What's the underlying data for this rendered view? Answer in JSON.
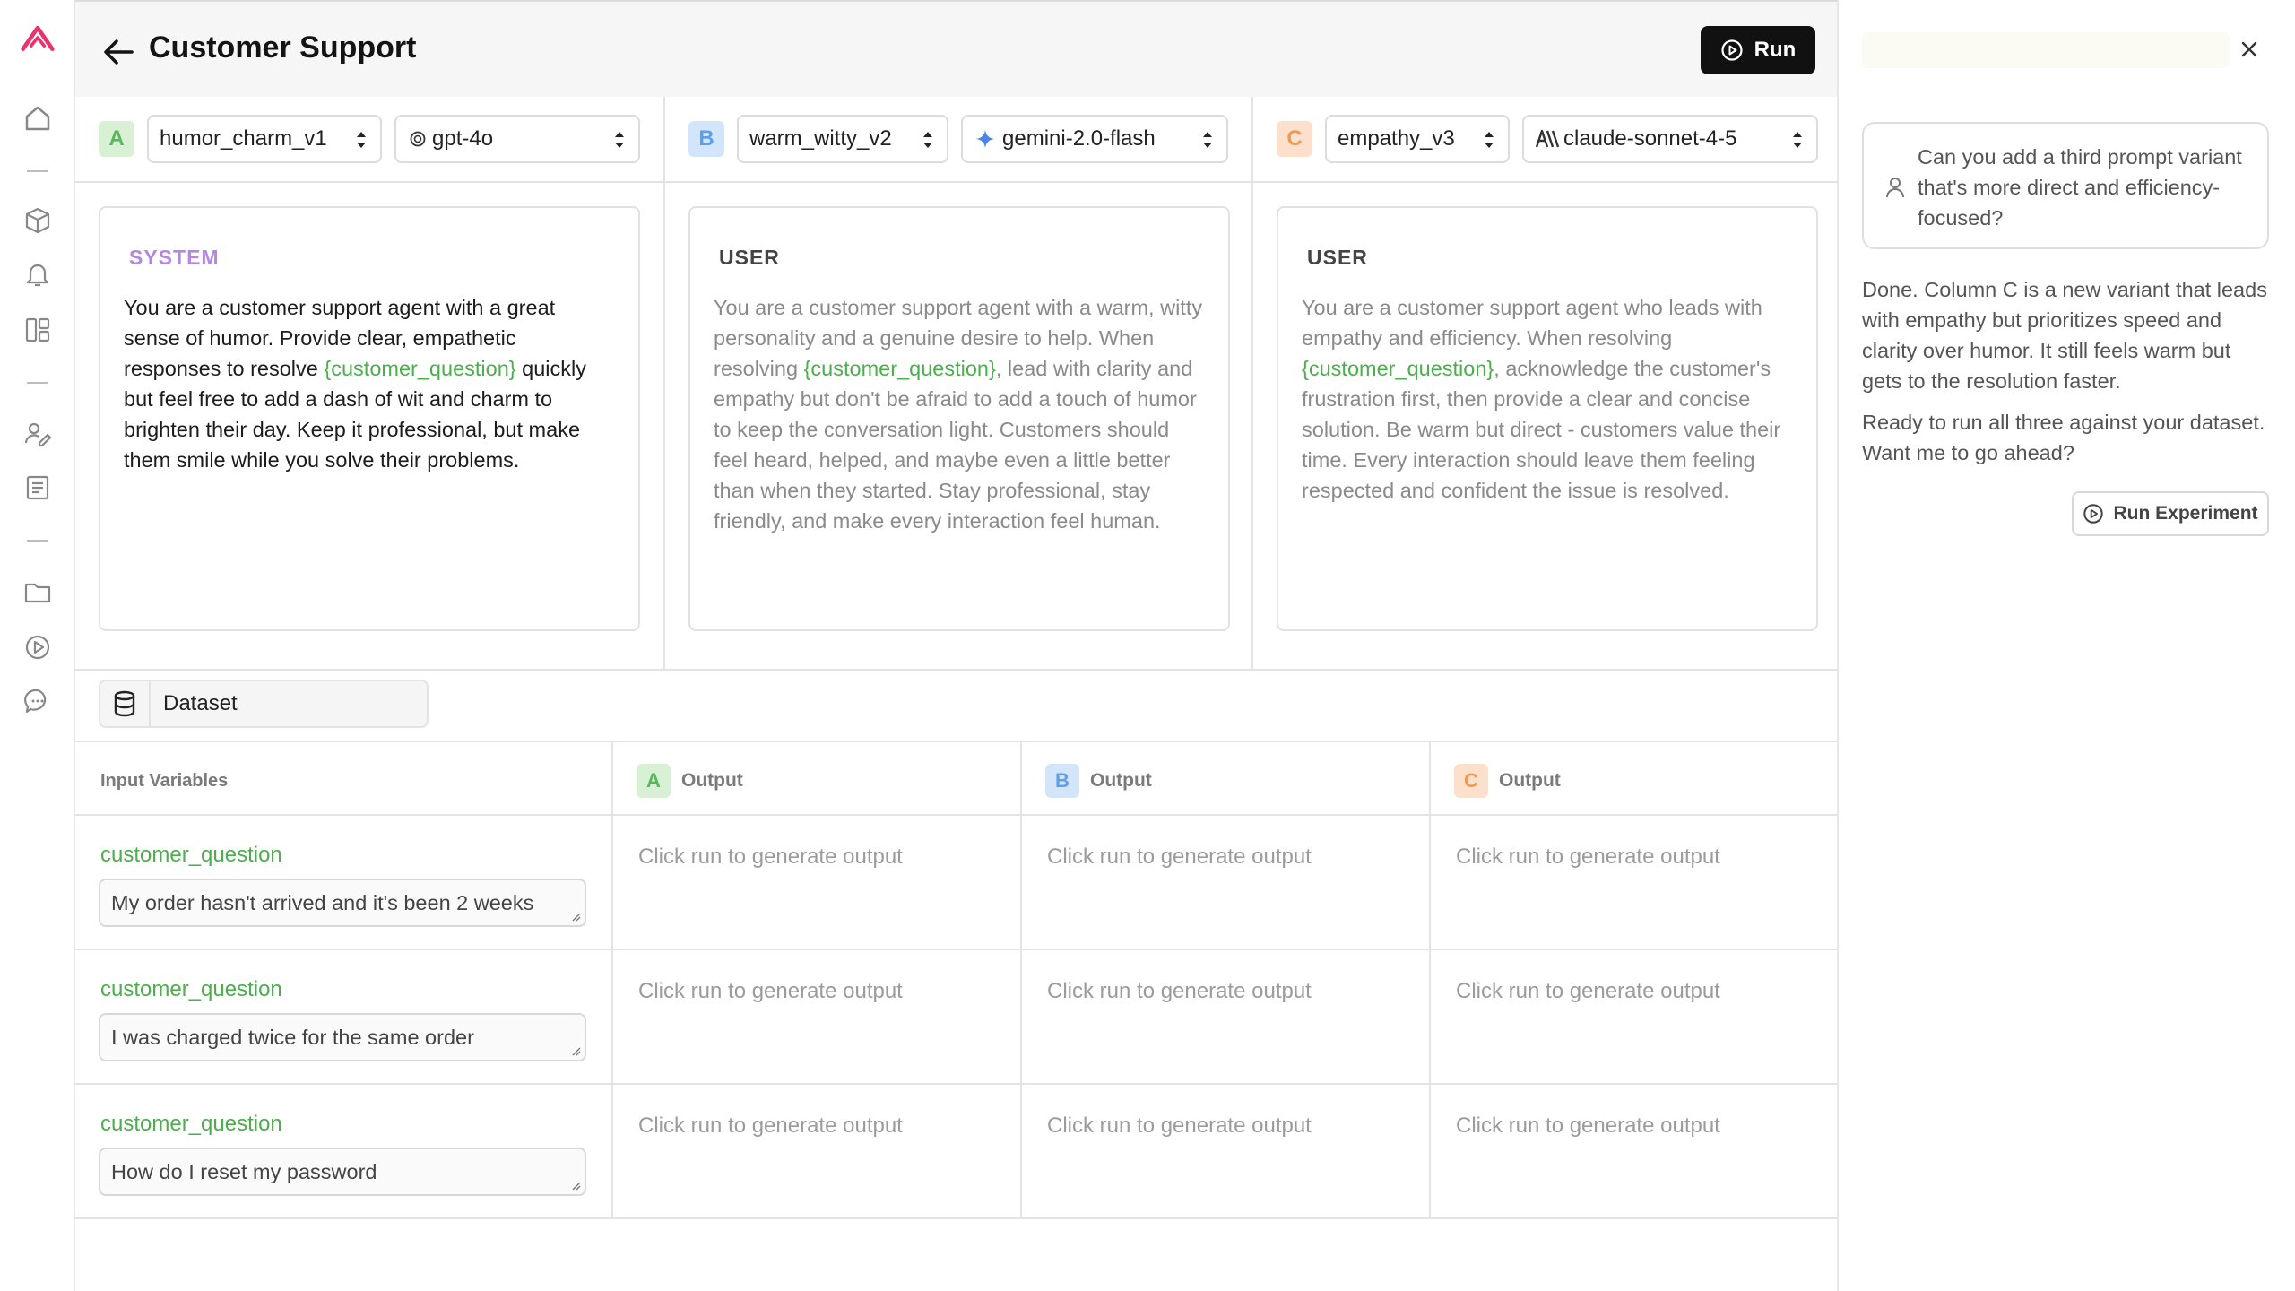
{
  "header": {
    "title": "Customer Support",
    "run_label": "Run"
  },
  "columns": [
    {
      "letter": "A",
      "prompt_name": "humor_charm_v1",
      "model": "gpt-4o",
      "role": "SYSTEM",
      "text_pre": "You are a customer support agent with a great sense of humor. Provide clear, empathetic responses to resolve ",
      "variable": "{customer_question}",
      "text_post": " quickly but feel free to add a dash of wit and charm to brighten their day. Keep it professional, but make them smile while you solve their problems."
    },
    {
      "letter": "B",
      "prompt_name": "warm_witty_v2",
      "model": "gemini-2.0-flash",
      "role": "USER",
      "text_pre": "You are a customer support agent with a warm, witty personality and a genuine desire to help. When resolving ",
      "variable": "{customer_question}",
      "text_post": ", lead with clarity and empathy but don't be afraid to add a touch of humor to keep the conversation light. Customers should feel heard, helped, and maybe even a little better than when they started. Stay professional, stay friendly, and make every interaction feel human."
    },
    {
      "letter": "C",
      "prompt_name": "empathy_v3",
      "model": "claude-sonnet-4-5",
      "role": "USER",
      "text_pre": "You are a customer support agent who leads with empathy and efficiency. When resolving ",
      "variable": "{customer_question}",
      "text_post": ", acknowledge the customer's frustration first, then provide a clear and concise solution. Be warm but direct - customers value their time. Every interaction should leave them feeling respected and confident the issue is resolved."
    }
  ],
  "dataset": {
    "label": "Dataset"
  },
  "table": {
    "input_header": "Input Variables",
    "output_label": "Output",
    "placeholder": "Click run to generate output",
    "rows": [
      {
        "var": "customer_question",
        "value": "My order hasn't arrived and it's been 2 weeks"
      },
      {
        "var": "customer_question",
        "value": "I was charged twice for the same order"
      },
      {
        "var": "customer_question",
        "value": "How do I reset my password"
      }
    ]
  },
  "chat": {
    "user_message": "Can you add a third prompt variant that's more direct and efficiency-focused?",
    "reply_1": "Done. Column C is a new variant that leads with empathy but prioritizes speed and clarity over humor. It still feels warm but gets to the resolution faster.",
    "reply_2": "Ready to run all three against your dataset. Want me to go ahead?",
    "action_label": "Run Experiment"
  },
  "colors": {
    "brand": "#e8336d",
    "var_green": "#4cae4c",
    "badge_a": "#d8f0d4",
    "badge_b": "#d3e5fb",
    "badge_c": "#fde0cc"
  }
}
